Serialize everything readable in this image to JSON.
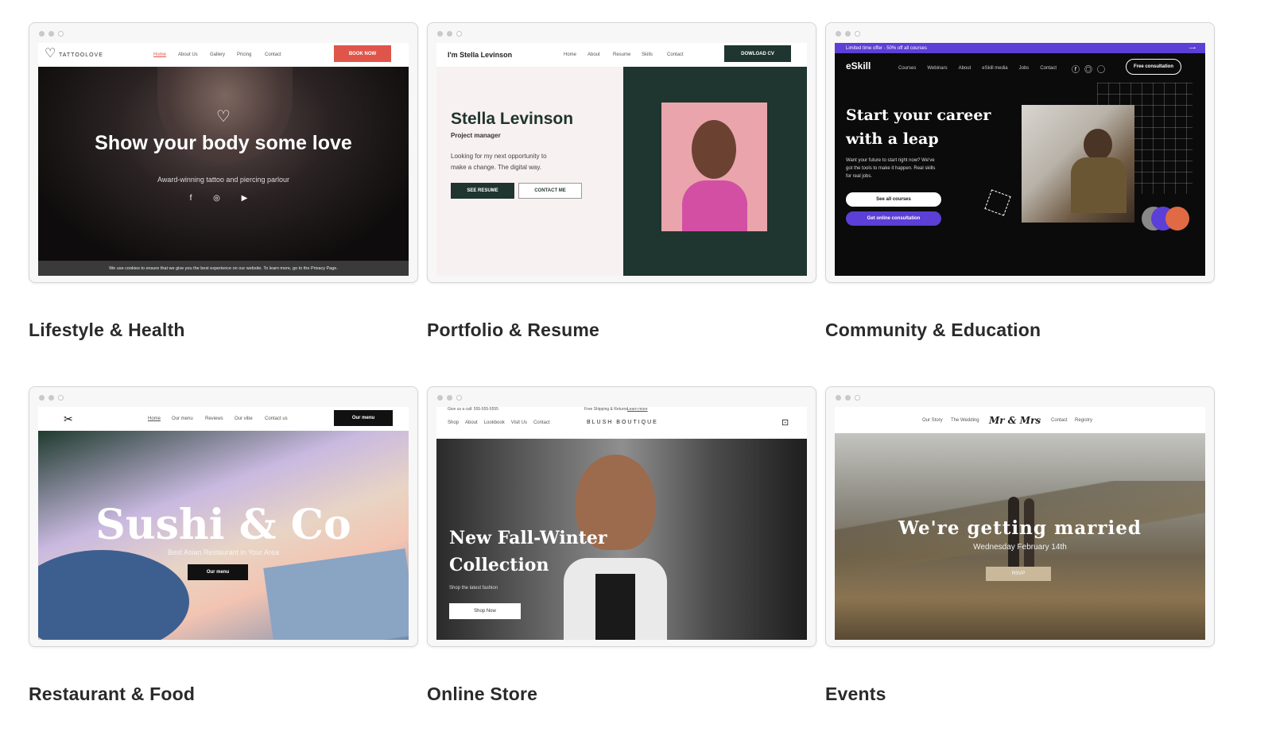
{
  "cards": {
    "lifestyle": {
      "label": "Lifestyle & Health",
      "logo": "TATTOOLOVE",
      "nav": [
        "Home",
        "About Us",
        "Gallery",
        "Pricing",
        "Contact"
      ],
      "cta": "BOOK NOW",
      "headline": "Show your body some love",
      "subtitle": "Award-winning tattoo and piercing parlour",
      "cookie": "We use cookies to ensure that we give you the best experience on our website. To learn more, go to the Privacy Page.",
      "accent": "#e0554a"
    },
    "portfolio": {
      "label": "Portfolio & Resume",
      "logo": "I'm Stella Levinson",
      "nav": [
        "Home",
        "About",
        "Resume",
        "Skills",
        "Contact"
      ],
      "cta": "DOWLOAD CV",
      "name": "Stella Levinson",
      "role": "Project manager",
      "bio_line1": "Looking for my next opportunity to",
      "bio_line2": "make a change. The digital way.",
      "btn_resume": "SEE RESUME",
      "btn_contact": "CONTACT ME",
      "accent": "#1f352f"
    },
    "community": {
      "label": "Community & Education",
      "offer": "Limited time offer - 50% off all courses",
      "logo": "eSkill",
      "nav": [
        "Courses",
        "Webinars",
        "About",
        "eSkill media",
        "Jobs",
        "Contact"
      ],
      "cta": "Free consultation",
      "headline_line1": "Start your career",
      "headline_line2": "with a leap",
      "body_line1": "Want your future to start right now? We've",
      "body_line2": "got the tools to make it happen. Real skills",
      "body_line3": "for real jobs.",
      "btn_courses": "See all courses",
      "btn_consult": "Get online consultation",
      "accent": "#5b3fd6"
    },
    "restaurant": {
      "label": "Restaurant & Food",
      "nav": [
        "Home",
        "Our menu",
        "Reviews",
        "Our vibe",
        "Contact us"
      ],
      "cta": "Our menu",
      "headline": "Sushi & Co",
      "subtitle": "Best Asian Restaurant in Your Area",
      "btn": "Our menu"
    },
    "store": {
      "label": "Online Store",
      "topbar_left": "Give us a call: 555-555-5555",
      "topbar_center": "Free Shipping & Returns",
      "topbar_link": "Learn more",
      "nav": [
        "Shop",
        "About",
        "Lookbook",
        "Visit Us",
        "Contact"
      ],
      "logo": "BLUSH BOUTIQUE",
      "headline_line1": "New Fall-Winter",
      "headline_line2": "Collection",
      "subtitle": "Shop the latest fashion",
      "btn": "Shop Now"
    },
    "events": {
      "label": "Events",
      "nav_left": [
        "Our Story",
        "The Wedding"
      ],
      "logo": "Mr & Mrs",
      "nav_right": [
        "Contact",
        "Registry"
      ],
      "headline": "We're getting married",
      "date": "Wednesday February 14th",
      "btn": "RSVP"
    }
  }
}
